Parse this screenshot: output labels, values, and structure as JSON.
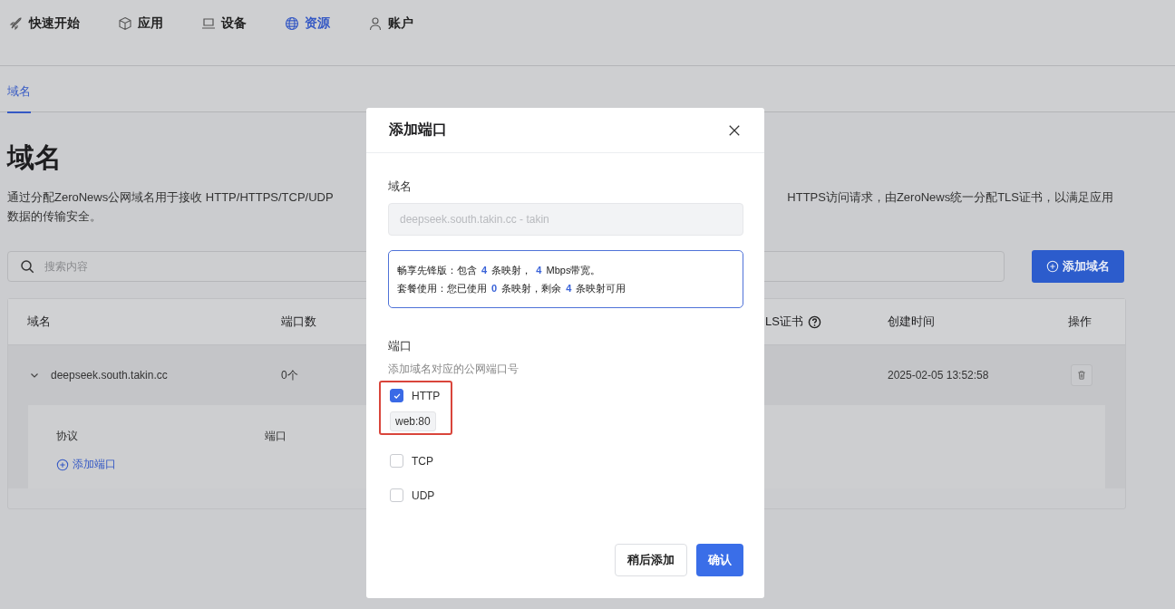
{
  "nav": [
    {
      "label": "快速开始",
      "selected": false
    },
    {
      "label": "应用",
      "selected": false
    },
    {
      "label": "设备",
      "selected": false
    },
    {
      "label": "资源",
      "selected": true
    },
    {
      "label": "账户",
      "selected": false
    }
  ],
  "tabs": [
    {
      "label": "域名",
      "selected": true
    }
  ],
  "page": {
    "title": "域名",
    "description_left": "通过分配ZeroNews公网域名用于接收 HTTP/HTTPS/TCP/UDP",
    "description_right": "HTTPS访问请求，由ZeroNews统一分配TLS证书，以满足应用",
    "description_line2": "数据的传输安全。"
  },
  "search": {
    "placeholder": "搜索内容"
  },
  "add_domain_button": "添加域名",
  "table": {
    "columns": [
      "域名",
      "端口数",
      "LS证书",
      "创建时间",
      "操作"
    ],
    "rows": [
      {
        "domain": "deepseek.south.takin.cc",
        "ports": "0个",
        "created": "2025-02-05 13:52:58",
        "expanded": true,
        "detail": {
          "columns": [
            "协议",
            "端口"
          ],
          "add_port": "添加端口"
        }
      }
    ]
  },
  "modal": {
    "title": "添加端口",
    "domain_label": "域名",
    "domain_value": "deepseek.south.takin.cc - takin",
    "info": [
      [
        {
          "text": "畅享先锋版：包含 "
        },
        {
          "text": "4",
          "highlight": true
        },
        {
          "text": " 条映射， "
        },
        {
          "text": "4",
          "highlight": true
        },
        {
          "text": " Mbps带宽。"
        }
      ],
      [
        {
          "text": "套餐使用：您已使用 "
        },
        {
          "text": "0",
          "highlight": true
        },
        {
          "text": " 条映射，剩余 "
        },
        {
          "text": "4",
          "highlight": true
        },
        {
          "text": " 条映射可用"
        }
      ]
    ],
    "port_label": "端口",
    "port_hint": "添加域名对应的公网端口号",
    "protocols": [
      {
        "label": "HTTP",
        "checked": true,
        "tag": "web:80",
        "highlighted": true
      },
      {
        "label": "TCP",
        "checked": false,
        "highlighted": false
      },
      {
        "label": "UDP",
        "checked": false,
        "highlighted": false
      }
    ],
    "buttons": [
      {
        "label": "稍后添加",
        "kind": "secondary"
      },
      {
        "label": "确认",
        "kind": "primary"
      }
    ]
  }
}
